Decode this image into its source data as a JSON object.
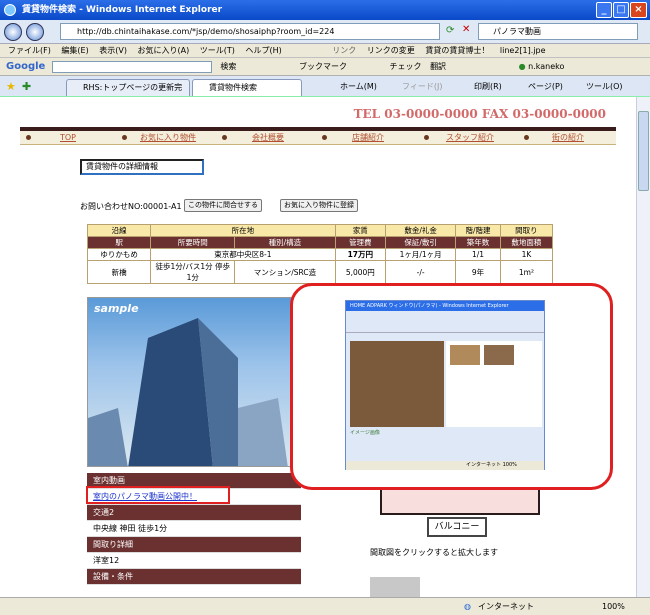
{
  "window": {
    "title": "賃貸物件検索 - Windows Internet Explorer"
  },
  "address": {
    "url": "http://db.chintaihakase.com/*jsp/demo/shosaiphp?room_id=224",
    "search_value": "パノラマ動画"
  },
  "menu": [
    "ファイル(F)",
    "編集(E)",
    "表示(V)",
    "お気に入り(A)",
    "ツール(T)",
    "ヘルプ(H)"
  ],
  "links_bar": {
    "label": "リンク",
    "items": [
      "リンクの変更",
      "賃貸の賃貸博士！",
      "line2[1].jpe"
    ]
  },
  "google_bar": {
    "brand": "Google",
    "search_label": "検索",
    "bookmarks": "ブックマーク",
    "check": "チェック",
    "translate": "翻訳",
    "user": "n.kaneko"
  },
  "tabs": [
    {
      "label": "RHS:トップページの更新完了"
    },
    {
      "label": "賃貸物件検索"
    }
  ],
  "command_bar": {
    "home": "ホーム(M)",
    "feed": "フィード(J)",
    "print": "印刷(R)",
    "page": "ページ(P)",
    "tools": "ツール(O)"
  },
  "site": {
    "tel": "TEL 03-0000-0000  FAX 03-0000-0000",
    "nav": [
      "TOP",
      "お気に入り物件",
      "会社概要",
      "店舗紹介",
      "スタッフ紹介",
      "街の紹介"
    ],
    "section_title": "賃貸物件の詳細情報",
    "inquiry": "お問い合わせNO:00001-A1",
    "buttons": {
      "ask": "この物件に問合せする",
      "favorite": "お気に入り物件に登録"
    },
    "table": {
      "header1": [
        "沿線",
        "所在地",
        "家賃",
        "敷金/礼金",
        "階/階建",
        "間取り"
      ],
      "header2": [
        "駅",
        "所要時間",
        "種別/構造",
        "管理費",
        "保証/敷引",
        "築年数",
        "敷地面積"
      ],
      "row1": [
        "ゆりかもめ",
        "東京都中央区8-1",
        "17万円",
        "1ヶ月/1ヶ月",
        "1/1",
        "1K"
      ],
      "row2": [
        "新橋",
        "徒歩1分/バス1分 停歩1分",
        "マンション/SRC造",
        "5,000円",
        "-/-",
        "9年",
        "1m²"
      ]
    },
    "photo_label": "sample",
    "sidebar": [
      {
        "label": "室内動画",
        "style": "dark"
      },
      {
        "label": "室内のパノラマ動画公開中！",
        "style": "link"
      },
      {
        "label": "交通2",
        "style": "dark"
      },
      {
        "label": "中央線  神田  徒歩1分",
        "style": "light"
      },
      {
        "label": "間取り詳細",
        "style": "dark"
      },
      {
        "label": "洋室12",
        "style": "light"
      },
      {
        "label": "設備・条件",
        "style": "dark"
      }
    ],
    "balcony": "バルコニー",
    "floor_caption": "間取図をクリックすると拡大します"
  },
  "popup": {
    "title": "HOME ADPARK ウィンドウ(パノラマ) - Windows Internet Explorer",
    "caption": "イメージ画像",
    "status": "インターネット",
    "zoom": "100%"
  },
  "status": {
    "zone": "インターネット",
    "zoom": "100%"
  }
}
